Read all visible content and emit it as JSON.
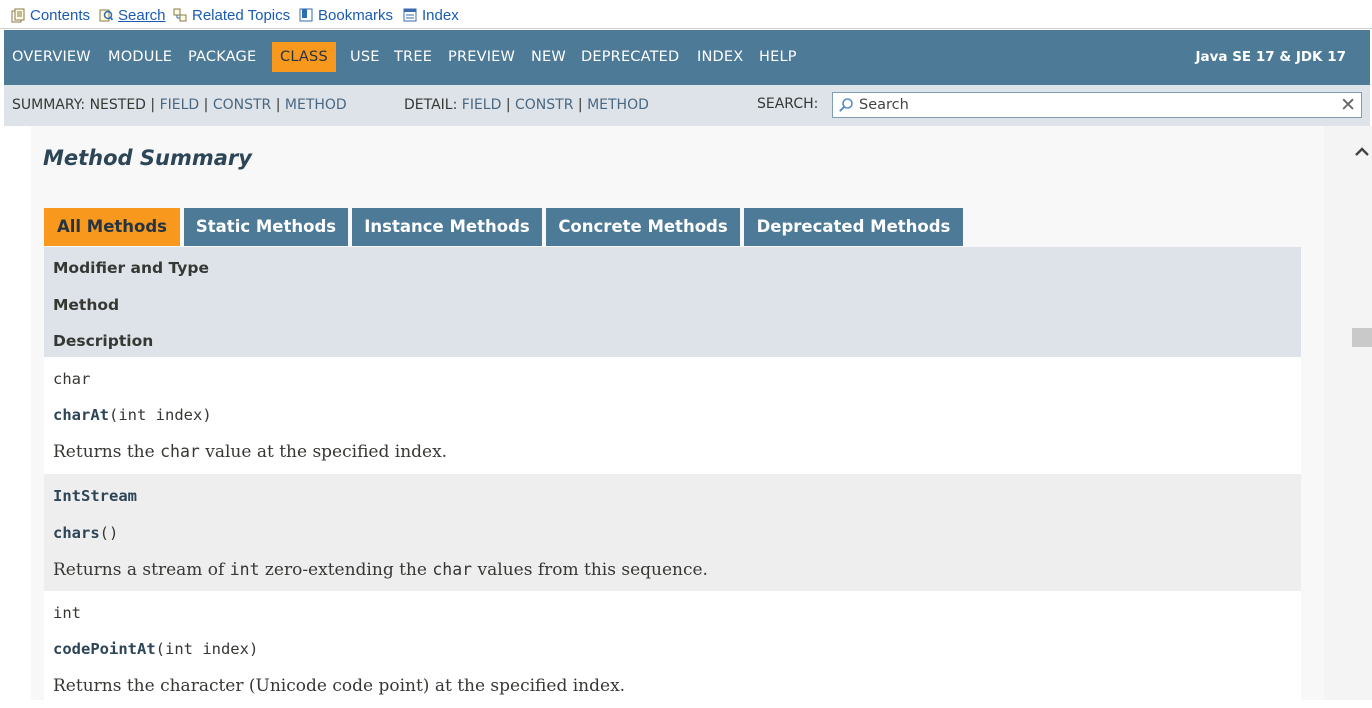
{
  "helpbar": {
    "contents": "Contents",
    "search": "Search",
    "related_topics": "Related Topics",
    "bookmarks": "Bookmarks",
    "index": "Index"
  },
  "topnav": {
    "items": [
      "OVERVIEW",
      "MODULE",
      "PACKAGE",
      "CLASS",
      "USE",
      "TREE",
      "PREVIEW",
      "NEW",
      "DEPRECATED",
      "INDEX",
      "HELP"
    ],
    "active": "CLASS",
    "about": "Java SE 17 & JDK 17"
  },
  "subnav": {
    "summary_label": "SUMMARY:",
    "summary_nested": "NESTED",
    "summary_field": "FIELD",
    "summary_constr": "CONSTR",
    "summary_method": "METHOD",
    "detail_label": "DETAIL:",
    "detail_field": "FIELD",
    "detail_constr": "CONSTR",
    "detail_method": "METHOD",
    "separator": "|",
    "search_label": "SEARCH:",
    "search_placeholder": "Search"
  },
  "method_summary": {
    "title": "Method Summary",
    "tabs": [
      "All Methods",
      "Static Methods",
      "Instance Methods",
      "Concrete Methods",
      "Deprecated Methods"
    ],
    "active_tab": "All Methods",
    "headers": {
      "modifier": "Modifier and Type",
      "method": "Method",
      "description": "Description"
    },
    "rows": [
      {
        "type": "char",
        "method_name": "charAt",
        "params": "(int index)",
        "desc_parts": [
          "Returns the ",
          "char",
          " value at the specified index."
        ]
      },
      {
        "type": "IntStream",
        "method_name": "chars",
        "params": "()",
        "desc_parts": [
          "Returns a stream of ",
          "int",
          " zero-extending the ",
          "char",
          " values from this sequence."
        ]
      },
      {
        "type": "int",
        "method_name": "codePointAt",
        "params": "(int index)",
        "desc_parts": [
          "Returns the character (Unicode code point) at the specified index."
        ]
      }
    ]
  },
  "colors": {
    "nav_blue": "#4d7a97",
    "active_orange": "#f8981d",
    "subnav_gray": "#dee3e9",
    "link_blue": "#4a6782"
  }
}
